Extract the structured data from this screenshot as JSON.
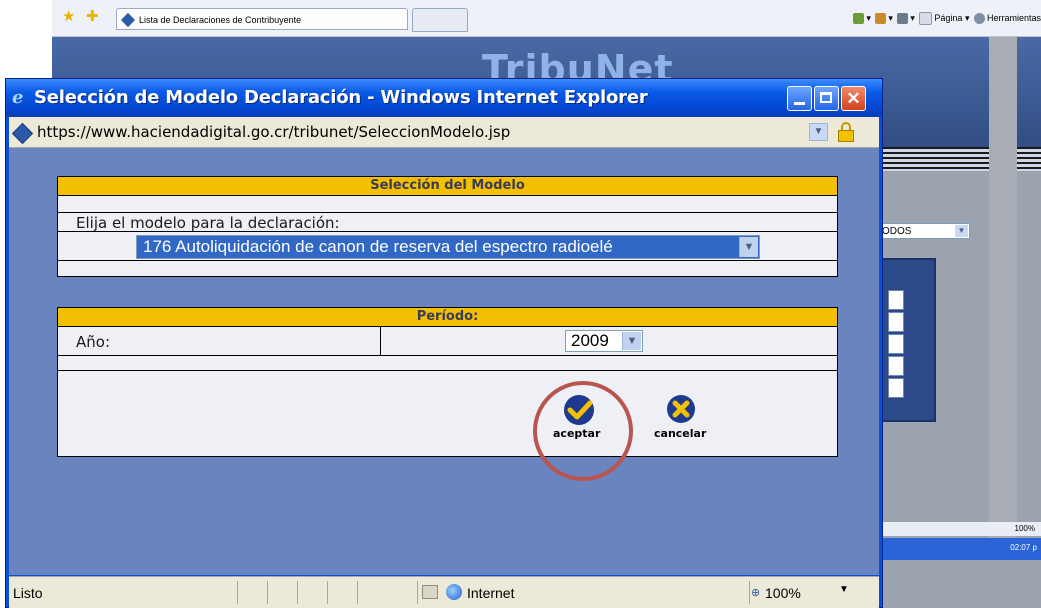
{
  "background_browser": {
    "tab_title": "Lista de Declaraciones de Contribuyente",
    "cmd_page": "Página",
    "cmd_tools": "Herramientas",
    "site_logo": "TribuNet",
    "select_value": "ODOS",
    "zoom": "100%",
    "clock": "02:07 p"
  },
  "window": {
    "title": "Selección de Modelo Declaración - Windows Internet Explorer",
    "url": "https://www.haciendadigital.go.cr/tribunet/SeleccionModelo.jsp"
  },
  "model_panel": {
    "header": "Selección del Modelo",
    "prompt": "Elija el modelo para la declaración:",
    "selected_model": "176 Autoliquidación de canon de reserva del espectro radioelé"
  },
  "period_panel": {
    "header": "Período:",
    "year_label": "Año:",
    "year_value": "2009"
  },
  "actions": {
    "accept_label": "aceptar",
    "cancel_label": "cancelar"
  },
  "statusbar": {
    "status": "Listo",
    "zone": "Internet",
    "zoom": "100%"
  },
  "colors": {
    "content_bg": "#6a84c0",
    "panel_header": "#f2c000",
    "highlight_circle": "#b9554e",
    "titlebar": "#0a5ae6"
  }
}
